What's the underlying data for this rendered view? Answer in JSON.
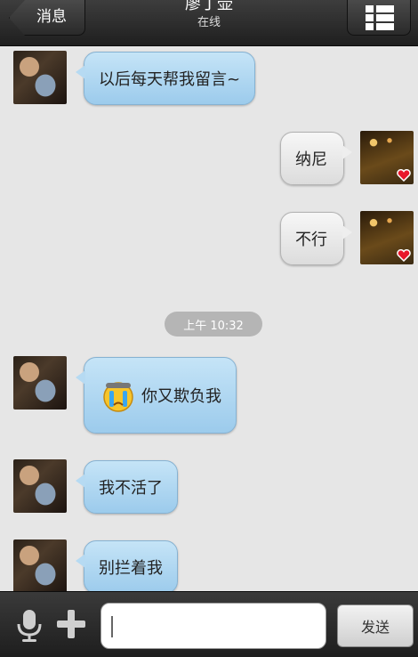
{
  "header": {
    "back_label": "消息",
    "contact_name": "廖丁壶",
    "status": "在线"
  },
  "messages": [
    {
      "side": "left",
      "text": "以后每天帮我留言~"
    },
    {
      "side": "right",
      "text": "纳尼"
    },
    {
      "side": "right",
      "text": "不行"
    },
    {
      "side": "left",
      "text": "你又欺负我",
      "emoji": "crying-face-icon"
    },
    {
      "side": "left",
      "text": "我不活了"
    },
    {
      "side": "left",
      "text": "别拦着我"
    }
  ],
  "timestamp": "上午 10:32",
  "input": {
    "value": "",
    "send_label": "发送"
  },
  "colors": {
    "left_bubble": "#b6daf2",
    "right_bubble": "#eeeeee",
    "header": "#2a2a2a"
  }
}
